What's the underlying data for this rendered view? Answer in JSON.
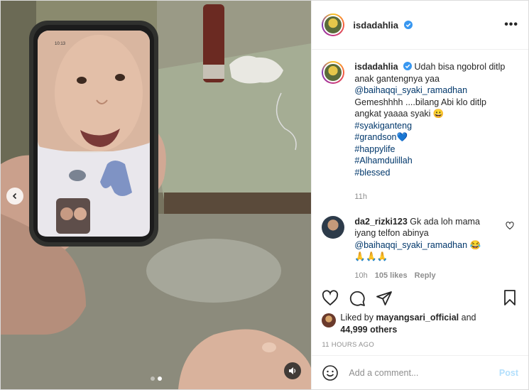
{
  "post": {
    "author": "isdadahlia",
    "caption_lines": [
      "Udah bisa ngobrol ditlp",
      "anak gantengnya yaa",
      "@baihaqqi_syaki_ramadhan",
      "Gemeshhhh ....bilang Abi klo ditlp",
      "angkat yaaaa syaki 😀",
      "#syakiganteng",
      "#grandson💙",
      "#happylife",
      "#Alhamdulillah",
      "#blessed"
    ],
    "caption_time": "11h",
    "more_label": "•••"
  },
  "comment": {
    "username": "da2_rizki123",
    "lines": [
      "Gk ada loh mama",
      "iyang telfon abinya",
      "@baihaqqi_syaki_ramadhan 😂",
      "🙏🙏🙏"
    ],
    "time": "10h",
    "likes": "105 likes",
    "reply": "Reply"
  },
  "likes": {
    "prefix": "Liked by ",
    "user": "mayangsari_official",
    "mid": " and",
    "others": "44,999 others"
  },
  "timestamp": "11 HOURS AGO",
  "add_comment": {
    "placeholder": "Add a comment...",
    "post_label": "Post"
  },
  "carousel": {
    "slide_count": 2,
    "active_index": 1
  },
  "colors": {
    "link": "#00376b",
    "verified": "#3897f0",
    "muted": "#8e8e8e",
    "post_disabled": "#b2dffc"
  },
  "phone_time": "10:13"
}
